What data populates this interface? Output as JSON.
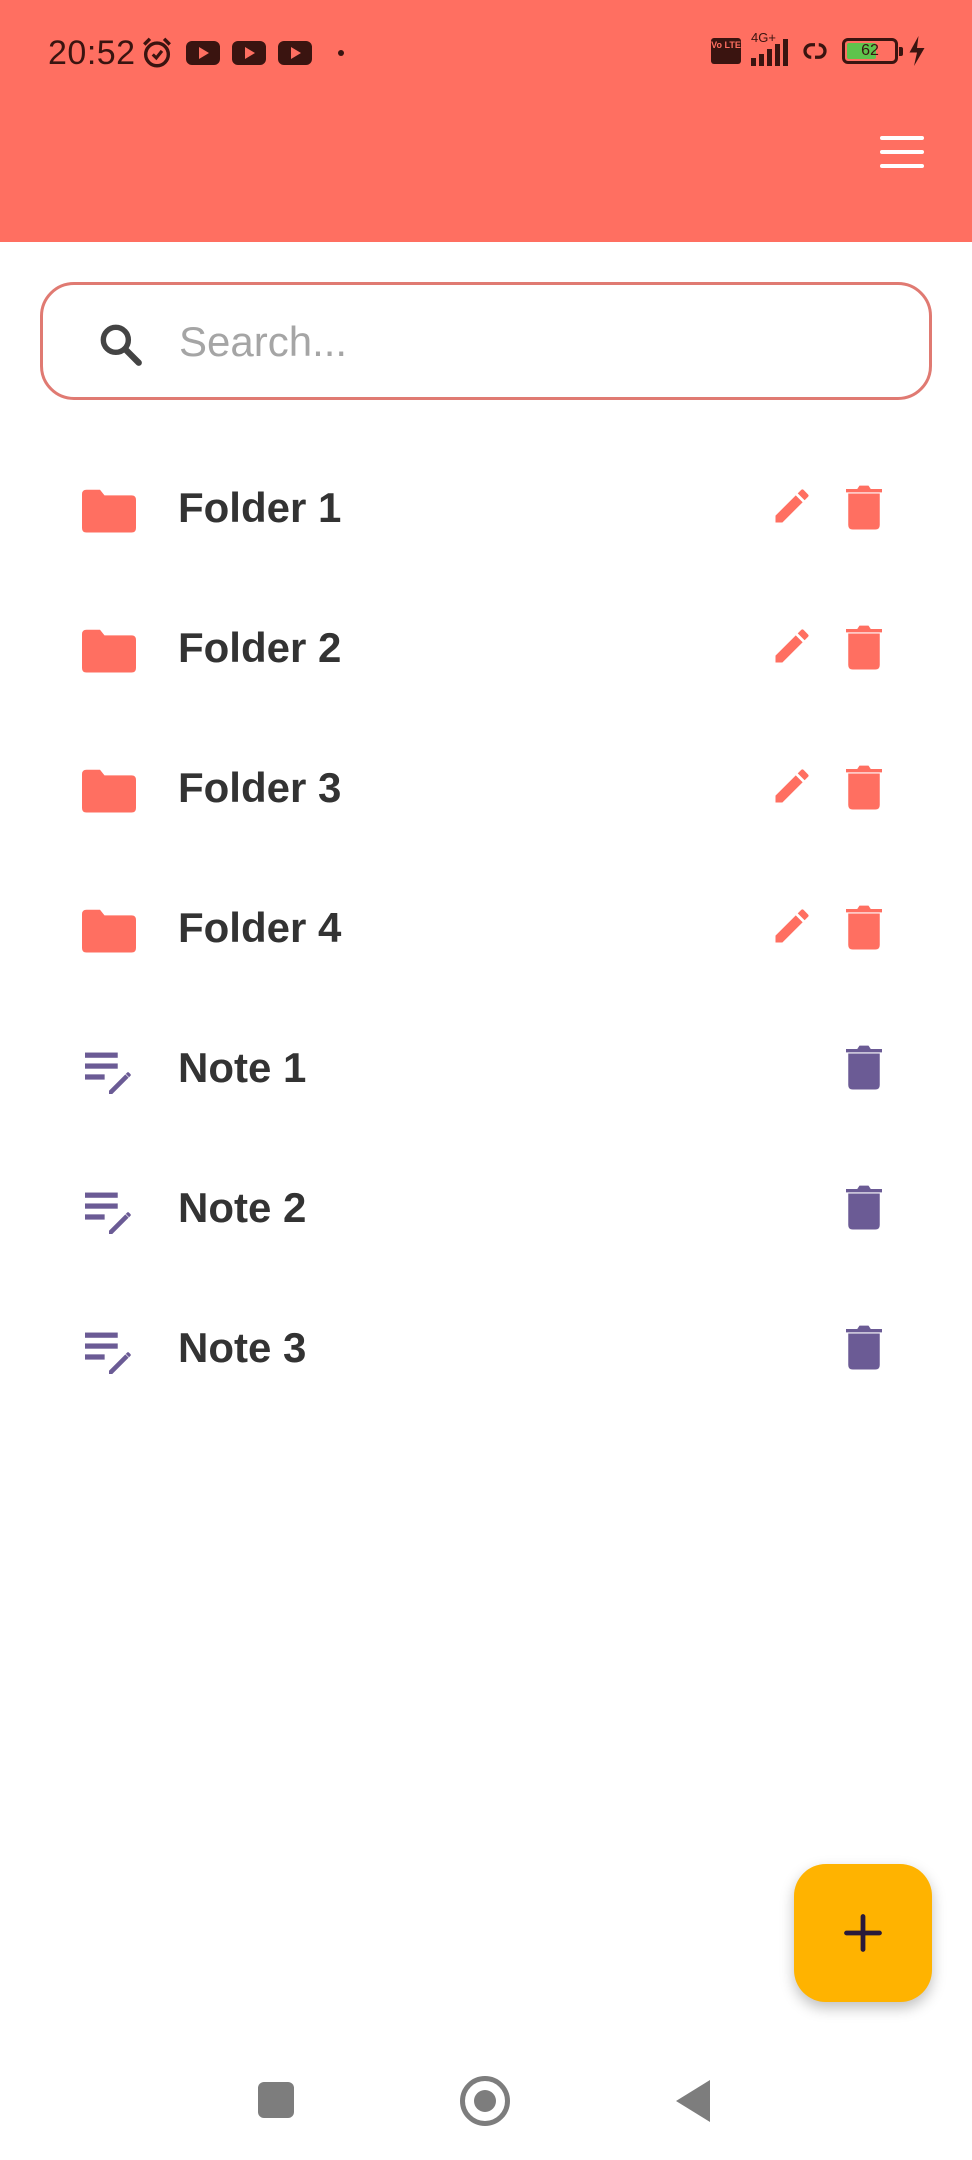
{
  "status_bar": {
    "time": "20:52",
    "network_label": "4G+",
    "volte_label": "Vo LTE",
    "battery_level": "62"
  },
  "search": {
    "placeholder": "Search..."
  },
  "items": [
    {
      "type": "folder",
      "label": "Folder 1"
    },
    {
      "type": "folder",
      "label": "Folder 2"
    },
    {
      "type": "folder",
      "label": "Folder 3"
    },
    {
      "type": "folder",
      "label": "Folder 4"
    },
    {
      "type": "note",
      "label": "Note 1"
    },
    {
      "type": "note",
      "label": "Note 2"
    },
    {
      "type": "note",
      "label": "Note 3"
    }
  ],
  "colors": {
    "app_bar": "#FF6F61",
    "folder_accent": "#FF6F61",
    "note_accent": "#6B5B95",
    "fab": "#FFB300",
    "text": "#333333"
  },
  "icons": {
    "menu": "hamburger-menu-icon",
    "search": "search-icon",
    "folder": "folder-icon",
    "note": "note-edit-icon",
    "edit": "pencil-icon",
    "delete": "trash-icon",
    "fab": "plus-icon"
  }
}
